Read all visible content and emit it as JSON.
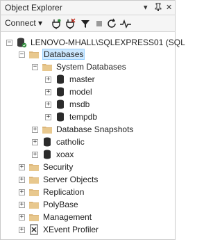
{
  "window": {
    "title": "Object Explorer",
    "pin_glyph": "▾",
    "pin2_glyph": "⌔",
    "close_glyph": "✕"
  },
  "toolbar": {
    "connect_label": "Connect ▾"
  },
  "tree": {
    "server": "LENOVO-MHALL\\SQLEXPRESS01 (SQL",
    "databases": "Databases",
    "system_databases": "System Databases",
    "sys_dbs": [
      "master",
      "model",
      "msdb",
      "tempdb"
    ],
    "snapshots": "Database Snapshots",
    "user_dbs": [
      "catholic",
      "xoax"
    ],
    "top_folders": [
      "Security",
      "Server Objects",
      "Replication",
      "PolyBase",
      "Management"
    ],
    "xevent": "XEvent Profiler"
  },
  "glyphs": {
    "expand": "+",
    "collapse": "−"
  },
  "colors": {
    "folder": "#dcb67a",
    "selection": "#cce8ff",
    "db": "#2b2b2b"
  }
}
